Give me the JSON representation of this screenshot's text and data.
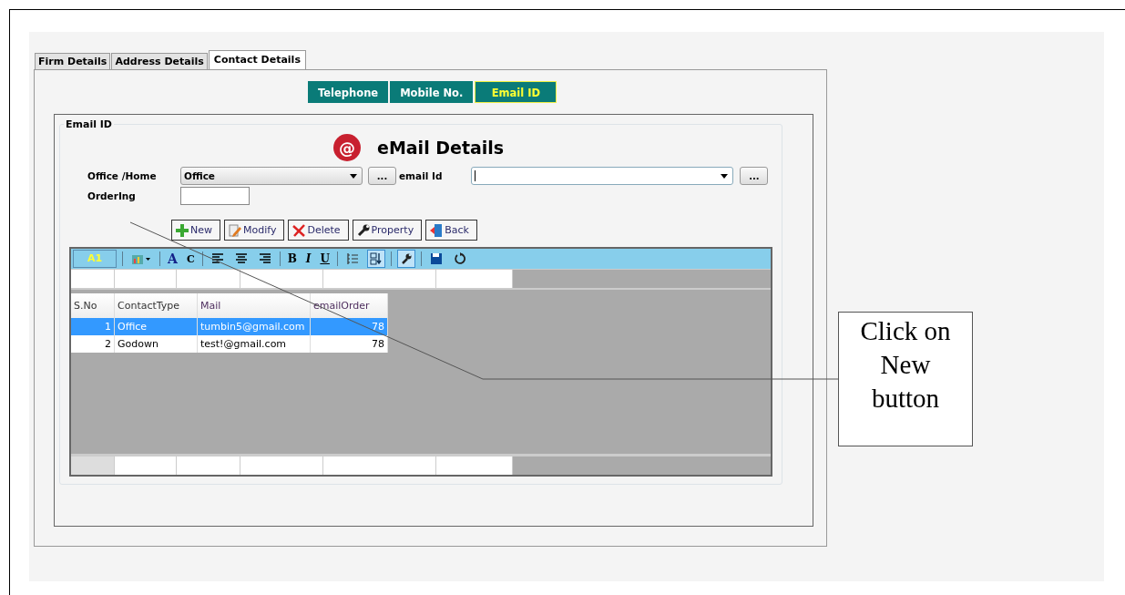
{
  "tabs": [
    {
      "label": "Firm Details",
      "selected": false
    },
    {
      "label": "Address Details",
      "selected": false
    },
    {
      "label": "Contact Details",
      "selected": true
    }
  ],
  "sub_tabs": [
    {
      "label": "Telephone",
      "selected": false
    },
    {
      "label": "Mobile No.",
      "selected": false
    },
    {
      "label": "Email ID",
      "selected": true
    }
  ],
  "group_title": "Email ID",
  "heading_icon": "@",
  "heading": "eMail Details",
  "form": {
    "office_home_label": "Office /Home",
    "office_home_value": "Office",
    "office_more_button": "...",
    "email_label": "email Id",
    "email_more_button": "...",
    "ordering_label": "OrderIng"
  },
  "buttons": [
    {
      "label": "New",
      "kind": "new"
    },
    {
      "label": "Modify",
      "kind": "modify"
    },
    {
      "label": "Delete",
      "kind": "delete"
    },
    {
      "label": "Property",
      "kind": "property"
    },
    {
      "label": "Back",
      "kind": "back"
    }
  ],
  "toolbar": [
    {
      "kind": "cell",
      "text": "A1"
    },
    {
      "kind": "sep"
    },
    {
      "kind": "chart"
    },
    {
      "kind": "sep"
    },
    {
      "kind": "font",
      "text": "A"
    },
    {
      "kind": "case",
      "text": "C"
    },
    {
      "kind": "sep"
    },
    {
      "kind": "align-left"
    },
    {
      "kind": "align-center"
    },
    {
      "kind": "align-right"
    },
    {
      "kind": "sep"
    },
    {
      "kind": "bold",
      "text": "B"
    },
    {
      "kind": "italic",
      "text": "I"
    },
    {
      "kind": "underline",
      "text": "U"
    },
    {
      "kind": "sep"
    },
    {
      "kind": "list",
      "active": false
    },
    {
      "kind": "sort",
      "active": true
    },
    {
      "kind": "sep"
    },
    {
      "kind": "wrench",
      "active": true
    },
    {
      "kind": "sep"
    },
    {
      "kind": "save"
    },
    {
      "kind": "refresh"
    }
  ],
  "table": {
    "columns": [
      "S.No",
      "ContactType",
      "Mail",
      "emailOrder"
    ],
    "rows": [
      {
        "cells": [
          "1",
          "Office",
          "tumbin5@gmail.com",
          "78"
        ],
        "selected": true
      },
      {
        "cells": [
          "2",
          "Godown",
          "test!@gmail.com",
          "78"
        ],
        "selected": false
      }
    ]
  },
  "callout": "Click on New button"
}
